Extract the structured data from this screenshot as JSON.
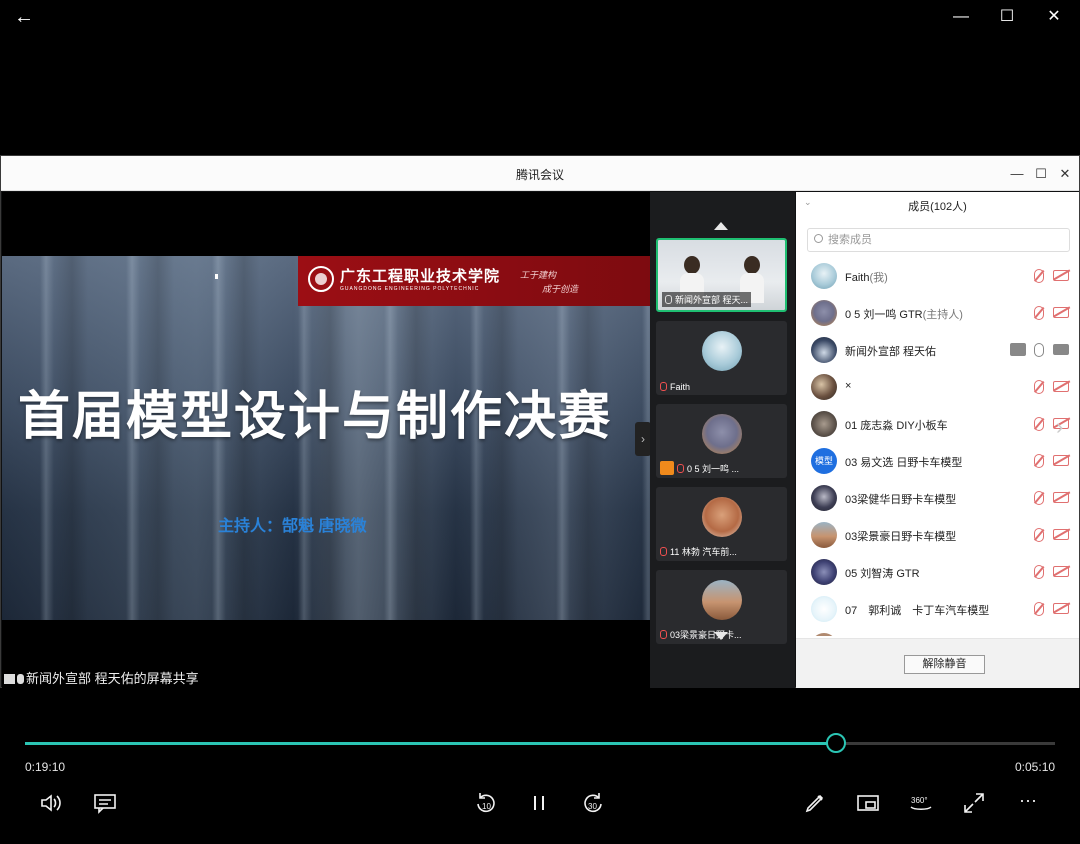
{
  "window": {
    "back_label": "←",
    "minimize": "—",
    "maximize": "☐",
    "close": "✕"
  },
  "meeting": {
    "app_title": "腾讯会议",
    "controls": {
      "minimize": "—",
      "maximize": "☐",
      "close": "✕"
    },
    "share": {
      "caption": "新闻外宣部 程天佑的屏幕共享",
      "slide": {
        "school_name": "广东工程职业技术学院",
        "school_name_en": "GUANGDONG ENGINEERING POLYTECHNIC",
        "motto_1": "工于建构",
        "motto_2": "成于创造",
        "title": "首届模型设计与制作决赛",
        "host": "主持人：郜魁 唐晓微"
      }
    },
    "expand_label": "›",
    "video_tiles": [
      {
        "name": "新闻外宣部 程天...",
        "mic": "on"
      },
      {
        "name": "Faith",
        "mic": "off"
      },
      {
        "name": "0 5 刘一鸣 ...",
        "mic": "off"
      },
      {
        "name": "11 林勃 汽车前...",
        "mic": "off"
      },
      {
        "name": "03梁景豪日野卡...",
        "mic": "off"
      }
    ],
    "members_panel": {
      "title": "成员(102人)",
      "search_placeholder": "搜索成员",
      "members": [
        {
          "name": "Faith",
          "tag": "(我)",
          "mic": "off",
          "cam": "off"
        },
        {
          "name": "0 5 刘一鸣 GTR",
          "tag": "(主持人)",
          "mic": "off",
          "cam": "off"
        },
        {
          "name": "新闻外宣部 程天佑",
          "tag": "",
          "mic": "on",
          "cam": "on",
          "sharing": true
        },
        {
          "name": "×",
          "tag": "",
          "mic": "off",
          "cam": "off"
        },
        {
          "name": "01 庞志淼 DIY小板车",
          "tag": "",
          "mic": "off",
          "cam": "off"
        },
        {
          "name": "03 易文选 日野卡车模型",
          "tag": "",
          "mic": "off",
          "cam": "off",
          "avatar_text": "模型"
        },
        {
          "name": "03梁健华日野卡车模型",
          "tag": "",
          "mic": "off",
          "cam": "off"
        },
        {
          "name": "03梁景豪日野卡车模型",
          "tag": "",
          "mic": "off",
          "cam": "off"
        },
        {
          "name": "05 刘智涛 GTR",
          "tag": "",
          "mic": "off",
          "cam": "off"
        },
        {
          "name": "07　郭利诚　卡丁车汽车模型",
          "tag": "",
          "mic": "off",
          "cam": "off"
        }
      ],
      "unmute_all": "解除静音"
    }
  },
  "player": {
    "elapsed": "0:19:10",
    "remaining": "0:05:10",
    "progress": 0.7874,
    "accent": "#2bc5b4",
    "controls": [
      "volume-icon",
      "subtitles-icon",
      "rewind-10-icon",
      "pause-icon",
      "forward-30-icon",
      "draw-icon",
      "mini-view-icon",
      "360-view-icon",
      "fullscreen-icon",
      "more-icon"
    ],
    "rewind_label": "10",
    "forward_label": "30",
    "view360_label": "360°",
    "more_label": "···"
  }
}
